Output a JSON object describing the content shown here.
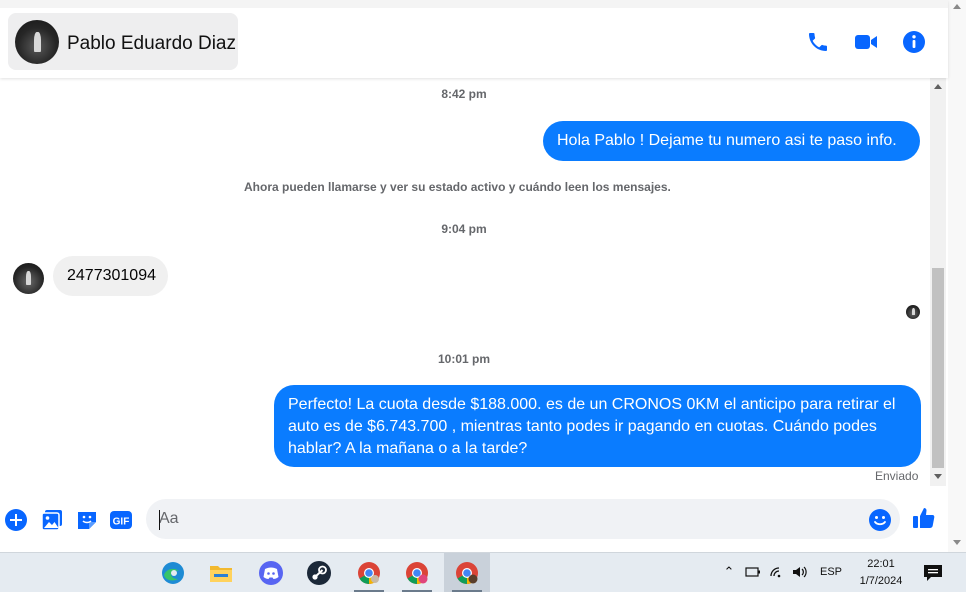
{
  "header": {
    "contact_name": "Pablo Eduardo Diaz"
  },
  "messages": {
    "time_1": "8:42 pm",
    "out_1": "Hola Pablo ! Dejame tu numero  asi te paso info.",
    "system_note": "Ahora pueden llamarse y ver su estado activo y cuándo leen los mensajes.",
    "time_2": "9:04 pm",
    "in_1": "2477301094",
    "time_3": "10:01 pm",
    "out_2": "Perfecto! La cuota desde $188.000. es de un CRONOS 0KM el anticipo para retirar el auto es de $6.743.700 , mientras tanto podes ir pagando en cuotas. Cuándo podes hablar? A la mañana o a la tarde?",
    "status": "Enviado"
  },
  "composer": {
    "placeholder": "Aa",
    "gif_label": "GIF"
  },
  "taskbar": {
    "language": "ESP",
    "time": "22:01",
    "date": "1/7/2024"
  },
  "colors": {
    "messenger_blue": "#0a7cff",
    "icon_blue": "#0866ff",
    "bubble_gray": "#f0f0f0"
  }
}
